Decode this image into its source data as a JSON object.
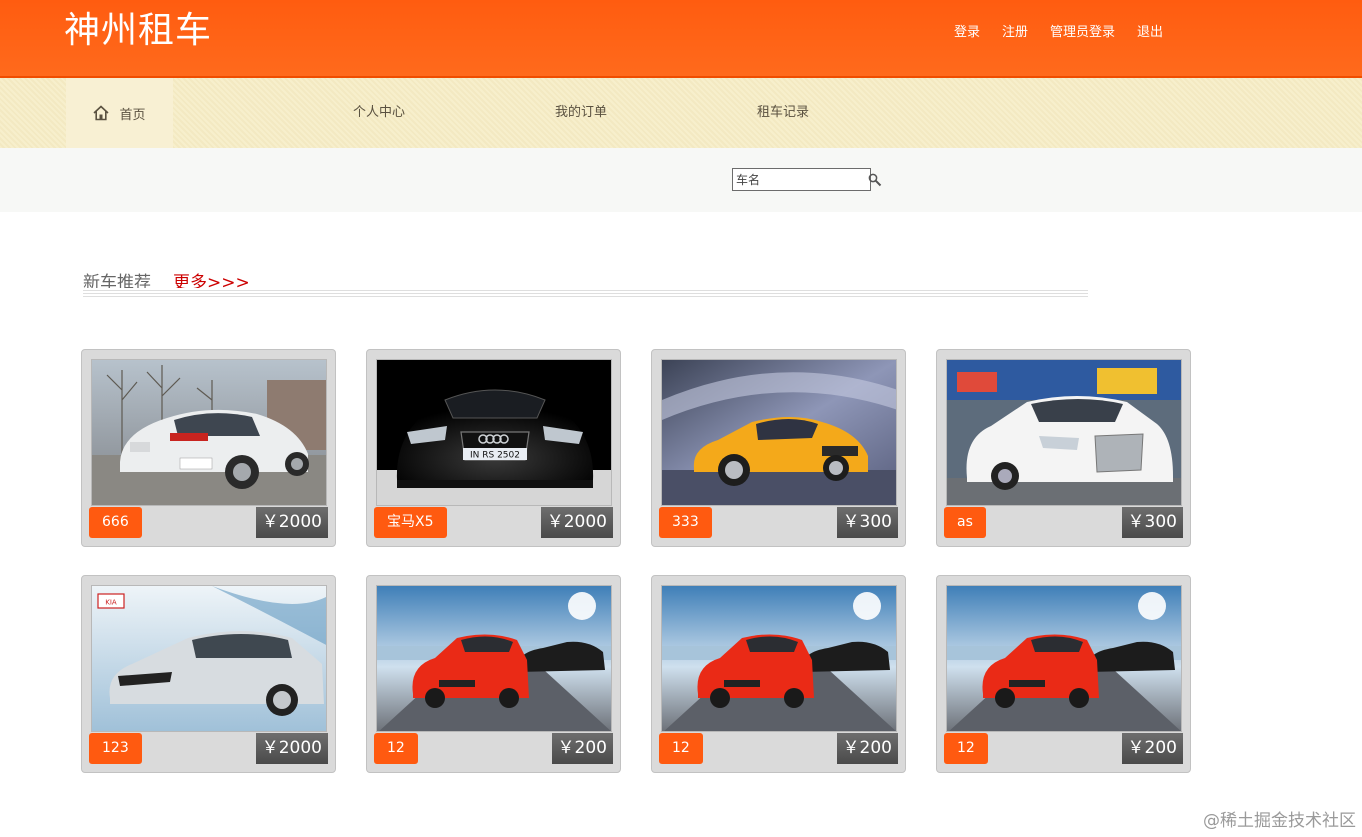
{
  "header": {
    "brand": "神州租车",
    "links": [
      "登录",
      "注册",
      "管理员登录",
      "退出"
    ]
  },
  "nav": {
    "home": "首页",
    "items": [
      "个人中心",
      "我的订单",
      "租车记录"
    ]
  },
  "search": {
    "placeholder": "车名"
  },
  "section": {
    "title": "新车推荐",
    "more": "更多>>>"
  },
  "cars": [
    {
      "name": "666",
      "price": "￥2000",
      "photo": "white-sedan-rear"
    },
    {
      "name": "宝马X5",
      "price": "￥2000",
      "photo": "black-audi-front"
    },
    {
      "name": "333",
      "price": "￥300",
      "photo": "orange-audi-tt"
    },
    {
      "name": "as",
      "price": "￥300",
      "photo": "white-audi-a8"
    },
    {
      "name": "123",
      "price": "￥2000",
      "photo": "silver-kia-k5"
    },
    {
      "name": "12",
      "price": "￥200",
      "photo": "red-bmw-3"
    },
    {
      "name": "12",
      "price": "￥200",
      "photo": "red-bmw-3"
    },
    {
      "name": "12",
      "price": "￥200",
      "photo": "red-bmw-3"
    }
  ],
  "watermark": "@稀土掘金技术社区"
}
